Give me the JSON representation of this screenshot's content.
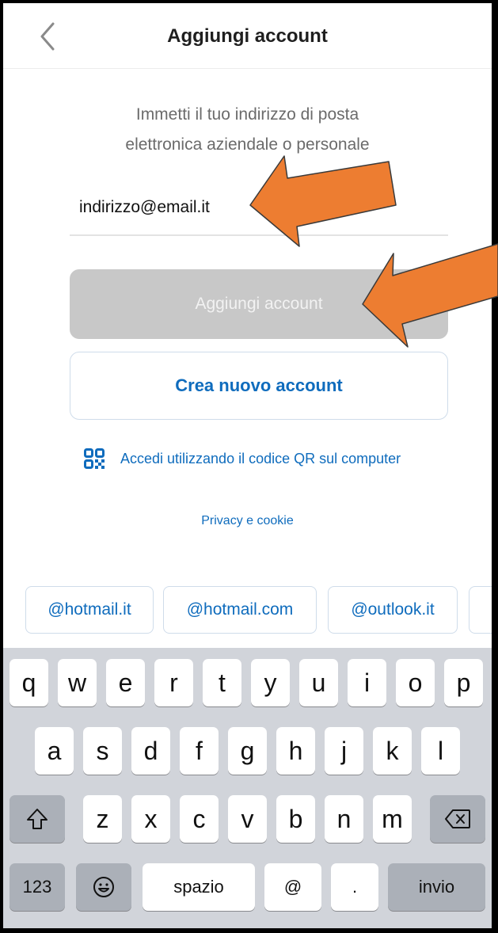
{
  "nav": {
    "title": "Aggiungi account",
    "back_icon": "chevron-left-icon"
  },
  "prompt": {
    "line1": "Immetti il tuo indirizzo di posta",
    "line2": "elettronica aziendale o personale"
  },
  "email_field": {
    "value": "indirizzo@email.it"
  },
  "buttons": {
    "add_account": "Aggiungi account",
    "create_account": "Crea nuovo account"
  },
  "qr_login": {
    "label": "Accedi utilizzando il codice QR sul computer",
    "icon": "qr-code-icon"
  },
  "privacy_link": "Privacy e cookie",
  "suggestions": [
    "@hotmail.it",
    "@hotmail.com",
    "@outlook.it",
    ""
  ],
  "keyboard": {
    "row1": [
      "q",
      "w",
      "e",
      "r",
      "t",
      "y",
      "u",
      "i",
      "o",
      "p"
    ],
    "row2": [
      "a",
      "s",
      "d",
      "f",
      "g",
      "h",
      "j",
      "k",
      "l"
    ],
    "row3": [
      "z",
      "x",
      "c",
      "v",
      "b",
      "n",
      "m"
    ],
    "shift_icon": "shift-icon",
    "backspace_icon": "backspace-icon",
    "numbers_key": "123",
    "emoji_icon": "emoji-icon",
    "space_key": "spazio",
    "at_key": "@",
    "dot_key": ".",
    "return_key": "invio"
  },
  "colors": {
    "accent_blue": "#0f6cbd",
    "annotation_arrow": "#ed7d31",
    "disabled_button": "#c8c8c8",
    "keyboard_bg": "#d1d4da"
  }
}
